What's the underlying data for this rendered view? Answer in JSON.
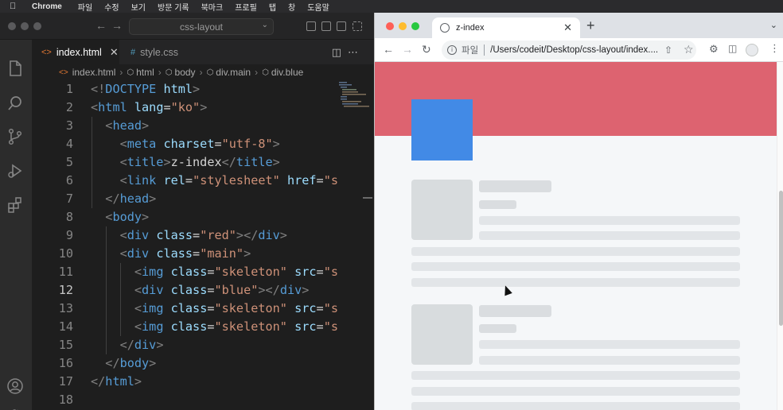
{
  "menubar": {
    "app_name": "Chrome",
    "items": [
      "파일",
      "수정",
      "보기",
      "방문 기록",
      "북마크",
      "프로필",
      "탭",
      "창",
      "도움말"
    ]
  },
  "vscode": {
    "command_center": "css-layout",
    "tabs": [
      {
        "label": "index.html",
        "active": true
      },
      {
        "label": "style.css",
        "active": false
      }
    ],
    "breadcrumb": [
      "index.html",
      "html",
      "body",
      "div.main",
      "div.blue"
    ],
    "current_line": 12,
    "lines": [
      {
        "n": "1",
        "tokens": [
          [
            "br",
            "<!"
          ],
          [
            "tag",
            "DOCTYPE"
          ],
          [
            "txt",
            " "
          ],
          [
            "attr",
            "html"
          ],
          [
            "br",
            ">"
          ]
        ]
      },
      {
        "n": "2",
        "tokens": [
          [
            "br",
            "<"
          ],
          [
            "tag",
            "html"
          ],
          [
            "txt",
            " "
          ],
          [
            "attr",
            "lang"
          ],
          [
            "txt",
            "="
          ],
          [
            "str",
            "\"ko\""
          ],
          [
            "br",
            ">"
          ]
        ]
      },
      {
        "n": "3",
        "tokens": [
          [
            "txt",
            "  "
          ],
          [
            "br",
            "<"
          ],
          [
            "tag",
            "head"
          ],
          [
            "br",
            ">"
          ]
        ]
      },
      {
        "n": "4",
        "tokens": [
          [
            "txt",
            "    "
          ],
          [
            "br",
            "<"
          ],
          [
            "tag",
            "meta"
          ],
          [
            "txt",
            " "
          ],
          [
            "attr",
            "charset"
          ],
          [
            "txt",
            "="
          ],
          [
            "str",
            "\"utf-8\""
          ],
          [
            "br",
            ">"
          ]
        ]
      },
      {
        "n": "5",
        "tokens": [
          [
            "txt",
            "    "
          ],
          [
            "br",
            "<"
          ],
          [
            "tag",
            "title"
          ],
          [
            "br",
            ">"
          ],
          [
            "txt",
            "z-index"
          ],
          [
            "br",
            "</"
          ],
          [
            "tag",
            "title"
          ],
          [
            "br",
            ">"
          ]
        ]
      },
      {
        "n": "6",
        "tokens": [
          [
            "txt",
            "    "
          ],
          [
            "br",
            "<"
          ],
          [
            "tag",
            "link"
          ],
          [
            "txt",
            " "
          ],
          [
            "attr",
            "rel"
          ],
          [
            "txt",
            "="
          ],
          [
            "str",
            "\"stylesheet\""
          ],
          [
            "txt",
            " "
          ],
          [
            "attr",
            "href"
          ],
          [
            "txt",
            "="
          ],
          [
            "str",
            "\"s"
          ]
        ]
      },
      {
        "n": "7",
        "tokens": [
          [
            "txt",
            "  "
          ],
          [
            "br",
            "</"
          ],
          [
            "tag",
            "head"
          ],
          [
            "br",
            ">"
          ]
        ]
      },
      {
        "n": "8",
        "tokens": [
          [
            "txt",
            "  "
          ],
          [
            "br",
            "<"
          ],
          [
            "tag",
            "body"
          ],
          [
            "br",
            ">"
          ]
        ]
      },
      {
        "n": "9",
        "tokens": [
          [
            "txt",
            "    "
          ],
          [
            "br",
            "<"
          ],
          [
            "tag",
            "div"
          ],
          [
            "txt",
            " "
          ],
          [
            "attr",
            "class"
          ],
          [
            "txt",
            "="
          ],
          [
            "str",
            "\"red\""
          ],
          [
            "br",
            "></"
          ],
          [
            "tag",
            "div"
          ],
          [
            "br",
            ">"
          ]
        ]
      },
      {
        "n": "10",
        "tokens": [
          [
            "txt",
            "    "
          ],
          [
            "br",
            "<"
          ],
          [
            "tag",
            "div"
          ],
          [
            "txt",
            " "
          ],
          [
            "attr",
            "class"
          ],
          [
            "txt",
            "="
          ],
          [
            "str",
            "\"main\""
          ],
          [
            "br",
            ">"
          ]
        ]
      },
      {
        "n": "11",
        "tokens": [
          [
            "txt",
            "      "
          ],
          [
            "br",
            "<"
          ],
          [
            "tag",
            "img"
          ],
          [
            "txt",
            " "
          ],
          [
            "attr",
            "class"
          ],
          [
            "txt",
            "="
          ],
          [
            "str",
            "\"skeleton\""
          ],
          [
            "txt",
            " "
          ],
          [
            "attr",
            "src"
          ],
          [
            "txt",
            "="
          ],
          [
            "str",
            "\"s"
          ]
        ]
      },
      {
        "n": "12",
        "tokens": [
          [
            "txt",
            "      "
          ],
          [
            "br",
            "<"
          ],
          [
            "tag",
            "div"
          ],
          [
            "txt",
            " "
          ],
          [
            "attr",
            "class"
          ],
          [
            "txt",
            "="
          ],
          [
            "str",
            "\"blue\""
          ],
          [
            "br",
            "></"
          ],
          [
            "tag",
            "div"
          ],
          [
            "br",
            ">"
          ]
        ]
      },
      {
        "n": "13",
        "tokens": [
          [
            "txt",
            "      "
          ],
          [
            "br",
            "<"
          ],
          [
            "tag",
            "img"
          ],
          [
            "txt",
            " "
          ],
          [
            "attr",
            "class"
          ],
          [
            "txt",
            "="
          ],
          [
            "str",
            "\"skeleton\""
          ],
          [
            "txt",
            " "
          ],
          [
            "attr",
            "src"
          ],
          [
            "txt",
            "="
          ],
          [
            "str",
            "\"s"
          ]
        ]
      },
      {
        "n": "14",
        "tokens": [
          [
            "txt",
            "      "
          ],
          [
            "br",
            "<"
          ],
          [
            "tag",
            "img"
          ],
          [
            "txt",
            " "
          ],
          [
            "attr",
            "class"
          ],
          [
            "txt",
            "="
          ],
          [
            "str",
            "\"skeleton\""
          ],
          [
            "txt",
            " "
          ],
          [
            "attr",
            "src"
          ],
          [
            "txt",
            "="
          ],
          [
            "str",
            "\"s"
          ]
        ]
      },
      {
        "n": "15",
        "tokens": [
          [
            "txt",
            "    "
          ],
          [
            "br",
            "</"
          ],
          [
            "tag",
            "div"
          ],
          [
            "br",
            ">"
          ]
        ]
      },
      {
        "n": "16",
        "tokens": [
          [
            "txt",
            "  "
          ],
          [
            "br",
            "</"
          ],
          [
            "tag",
            "body"
          ],
          [
            "br",
            ">"
          ]
        ]
      },
      {
        "n": "17",
        "tokens": [
          [
            "br",
            "</"
          ],
          [
            "tag",
            "html"
          ],
          [
            "br",
            ">"
          ]
        ]
      },
      {
        "n": "18",
        "tokens": []
      }
    ]
  },
  "chrome": {
    "tab_title": "z-index",
    "address_scheme": "파일",
    "address_path": "/Users/codeit/Desktop/css-layout/index....",
    "page_colors": {
      "red": "#dd6370",
      "blue": "#428ae6",
      "skeleton": "#d8dcde"
    }
  }
}
